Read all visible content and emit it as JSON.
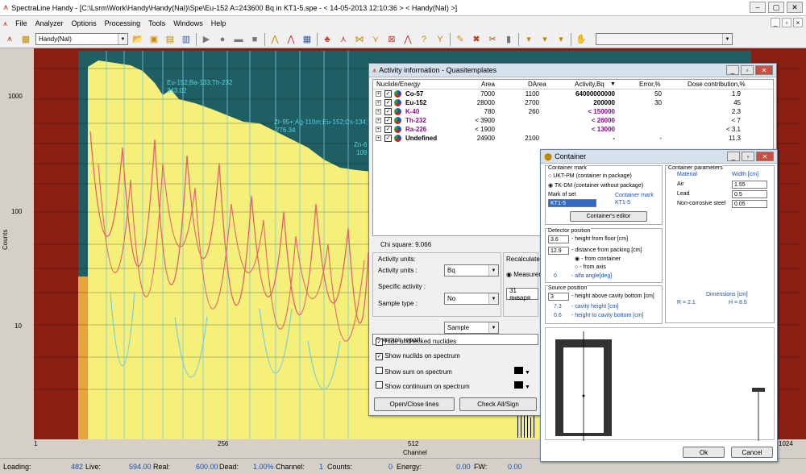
{
  "app": {
    "title": "SpectraLine Handy - [C:\\Lsrm\\Work\\Handy\\Handy(NaI)\\Spe\\Eu-152  A=243600 Bq  in KT1-5.spe - < 14-05-2013 12:10:36 > < Handy(NaI) >]"
  },
  "menu": [
    "File",
    "Analyzer",
    "Options",
    "Processing",
    "Tools",
    "Windows",
    "Help"
  ],
  "toolbar": {
    "device": "Handy(NaI)"
  },
  "plot": {
    "y_ticks": [
      "1000",
      "100",
      "10"
    ],
    "y_label": "Counts",
    "x_ticks": [
      "1",
      "256",
      "512",
      "1024"
    ],
    "x_label": "Channel",
    "annotations": [
      {
        "text": "Eu-152;Ba-133;Th-232",
        "sub": "343.02"
      },
      {
        "text": "Zr-95+;Ag-110m;Eu-152;Cs-134;Th-",
        "sub": "776.34"
      },
      {
        "text": "Zn-6",
        "sub": "109"
      }
    ]
  },
  "status": {
    "loading_label": "Loading:",
    "loading": "482",
    "live_label": "Live:",
    "live": "594.00",
    "real_label": "Real:",
    "real": "600.00",
    "dead_label": "Dead:",
    "dead": "1.00%",
    "channel_label": "Channel:",
    "channel": "1",
    "counts_label": "Counts:",
    "counts": "0",
    "energy_label": "Energy:",
    "energy": "0.00",
    "fw_label": "FW:",
    "fw": "0.00"
  },
  "activity": {
    "title": "Activity information - Quasitemplates",
    "headers": [
      "Nuclide/Energy",
      "Area",
      "DArea",
      "Activity,Bq",
      "Error,%",
      "Dose contribution,%"
    ],
    "rows": [
      {
        "name": "Co-57",
        "area": "7000",
        "darea": "1100",
        "activity": "64000000000",
        "error": "50",
        "dose": "1.9",
        "color": "#000000"
      },
      {
        "name": "Eu-152",
        "area": "28000",
        "darea": "2700",
        "activity": "200000",
        "error": "30",
        "dose": "45",
        "color": "#000000"
      },
      {
        "name": "K-40",
        "area": "780",
        "darea": "260",
        "activity": "< 150000",
        "error": "",
        "dose": "2.3",
        "color": "#8b0a8b"
      },
      {
        "name": "Th-232",
        "area": "< 3900",
        "darea": "",
        "activity": "< 26000",
        "error": "",
        "dose": "< 7",
        "color": "#8b0a8b"
      },
      {
        "name": "Ra-226",
        "area": "< 1900",
        "darea": "",
        "activity": "< 13000",
        "error": "",
        "dose": "< 3.1",
        "color": "#8b0a8b"
      },
      {
        "name": "Undefined",
        "area": "24900",
        "darea": "2100",
        "activity": "-",
        "error": "-",
        "dose": "11.3",
        "color": "#000000"
      }
    ],
    "chi_square": "Chi square: 9.066",
    "units_group": "Activity units:",
    "activity_units_label": "Activity units :",
    "activity_units": "Bq",
    "specific_label": "Specific activity :",
    "specific": "No",
    "sample_label": "Sample type :",
    "sample": "Sample",
    "recalc": "Recalculate",
    "measurement": "Measurem",
    "date": "31  января",
    "report": "Common report",
    "options": [
      {
        "label": "Hide unchecked nuclides",
        "checked": true
      },
      {
        "label": "Show nuclids on spectrum",
        "checked": true
      },
      {
        "label": "Show sum on spectrum",
        "checked": false
      },
      {
        "label": "Show continuum on spectrum",
        "checked": false
      }
    ],
    "btn_open": "Open/Close lines",
    "btn_check": "Check All/Sign"
  },
  "container": {
    "title": "Container",
    "mark_group": "Container mark",
    "radio1": "UKT-PM (container in package)",
    "radio2": "TK-DM (container without package)",
    "mark_of_set": "Mark of set",
    "mark_value": "KT1-5",
    "container_mark_label": "Container mark",
    "container_mark_value": "KT1-5",
    "editor_btn": "Container's editor",
    "params_group": "Container parameters",
    "material_header": "Material",
    "width_header": "Width [cm]",
    "materials": [
      {
        "name": "Air",
        "width": "1.55"
      },
      {
        "name": "Lead",
        "width": "0.5"
      },
      {
        "name": "Non-corrosive steel",
        "width": "0.05"
      }
    ],
    "dimensions_label": "Dimensions [cm]",
    "r_value": "R = 2.1",
    "h_value": "H = 8.5",
    "detector_group": "Detector position",
    "height_floor": "3.6",
    "height_floor_label": "- height from floor [cm]",
    "distance": "12.9",
    "distance_label": "- distance from packing [cm]",
    "from_container": "- from container",
    "from_axis": "- from axis",
    "alfa_value": "0",
    "alfa_label": "- alfa angle[deg]",
    "source_group": "Source position",
    "source_height": "3",
    "source_height_label": "- height above cavity bottom [cm]",
    "cavity_height_value": "7.3",
    "cavity_height_label": "- cavity height [cm]",
    "height_bottom_value": "0.6",
    "height_bottom_label": "- height to cavity bottom [cm]",
    "ok": "Ok",
    "cancel": "Cancel"
  },
  "colors": {
    "plot_bg": "#1f5f63",
    "spectrum_fill": "#f5f07a",
    "border_red": "#8b1e12",
    "curve_red": "#e8606a",
    "curve_blue": "#6fc8e8"
  }
}
